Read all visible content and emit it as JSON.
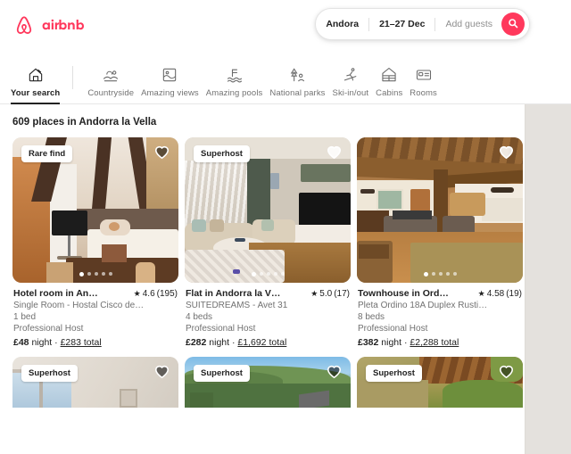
{
  "brand": {
    "name": "airbnb",
    "color": "#ff385c",
    "logo_icon": "airbnb-bowtie-logo"
  },
  "search": {
    "location_value": "Andora",
    "dates_value": "21–27 Dec",
    "guests_placeholder": "Add guests",
    "search_icon": "search-icon"
  },
  "categories": [
    {
      "label": "Your search",
      "icon": "house-search-icon",
      "active": true
    },
    {
      "label": "Countryside",
      "icon": "countryside-icon",
      "active": false
    },
    {
      "label": "Amazing views",
      "icon": "amazing-views-icon",
      "active": false
    },
    {
      "label": "Amazing pools",
      "icon": "amazing-pools-icon",
      "active": false
    },
    {
      "label": "National parks",
      "icon": "national-parks-icon",
      "active": false
    },
    {
      "label": "Ski-in/out",
      "icon": "skier-icon",
      "active": false
    },
    {
      "label": "Cabins",
      "icon": "cabin-icon",
      "active": false
    },
    {
      "label": "Rooms",
      "icon": "rooms-icon",
      "active": false
    }
  ],
  "results": {
    "heading": "609 places in Andorra la Vella",
    "listings": [
      {
        "badge": "Rare find",
        "title": "Hotel room in An…",
        "rating": "4.6",
        "reviews": "(195)",
        "subtitle": "Single Room - Hostal Cisco de…",
        "beds": "1 bed",
        "host": "Professional Host",
        "price_night": "£48",
        "price_night_suffix": "night",
        "price_total": "£283 total",
        "dots": 5,
        "active_dot": 0,
        "photo_alt": "rustic-bedroom-wood-beams",
        "heart_icon": "heart-icon"
      },
      {
        "badge": "Superhost",
        "title": "Flat in Andorra la V…",
        "rating": "5.0",
        "reviews": "(17)",
        "subtitle": "SUITEDREAMS - Avet 31",
        "beds": "4 beds",
        "host": "Professional Host",
        "price_night": "£282",
        "price_night_suffix": "night",
        "price_total": "£1,692 total",
        "dots": 5,
        "active_dot": 0,
        "photo_alt": "modern-living-room-sofas-tv",
        "heart_icon": "heart-icon"
      },
      {
        "badge": "",
        "title": "Townhouse in Ord…",
        "rating": "4.58",
        "reviews": "(19)",
        "subtitle": "Pleta Ordino 18A Duplex Rusti…",
        "beds": "8 beds",
        "host": "Professional Host",
        "price_night": "£382",
        "price_night_suffix": "night",
        "price_total": "£2,288 total",
        "dots": 5,
        "active_dot": 0,
        "photo_alt": "rustic-chalet-living-room-fireplace",
        "heart_icon": "heart-icon"
      }
    ],
    "listings_row2": [
      {
        "badge": "Superhost",
        "photo_alt": "white-bedroom-window",
        "heart_icon": "heart-icon"
      },
      {
        "badge": "Superhost",
        "photo_alt": "green-mountain-valley-view",
        "heart_icon": "heart-icon"
      },
      {
        "badge": "Superhost",
        "photo_alt": "stone-cottage-exterior-garden",
        "heart_icon": "heart-icon"
      }
    ]
  },
  "map": {
    "label": "map-panel"
  }
}
